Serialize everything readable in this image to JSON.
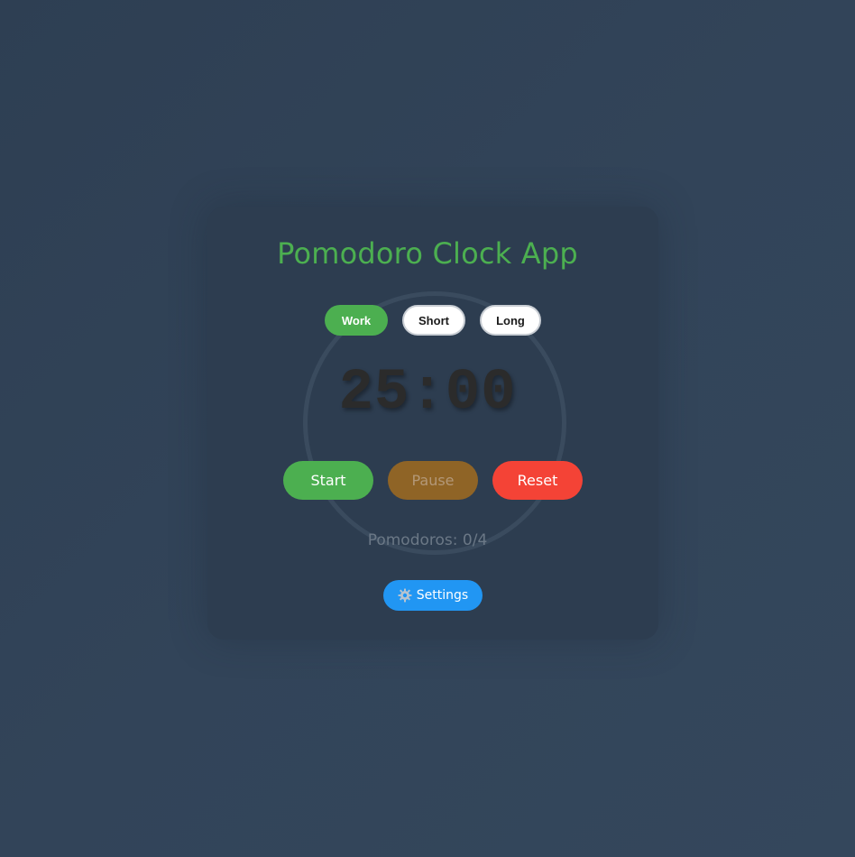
{
  "app": {
    "title": "Pomodoro Clock App"
  },
  "modes": [
    {
      "label": "Work",
      "active": true
    },
    {
      "label": "Short",
      "active": false
    },
    {
      "label": "Long",
      "active": false
    }
  ],
  "timer": {
    "display": "25:00"
  },
  "controls": {
    "start_label": "Start",
    "pause_label": "Pause",
    "reset_label": "Reset"
  },
  "counter": {
    "text": "Pomodoros: 0/4"
  },
  "settings": {
    "label": "Settings",
    "icon": "gear-icon"
  },
  "colors": {
    "accent": "#4caf50",
    "pause": "#8f6426",
    "reset": "#f44336",
    "settings": "#2196f3",
    "background": "#2f4155"
  }
}
